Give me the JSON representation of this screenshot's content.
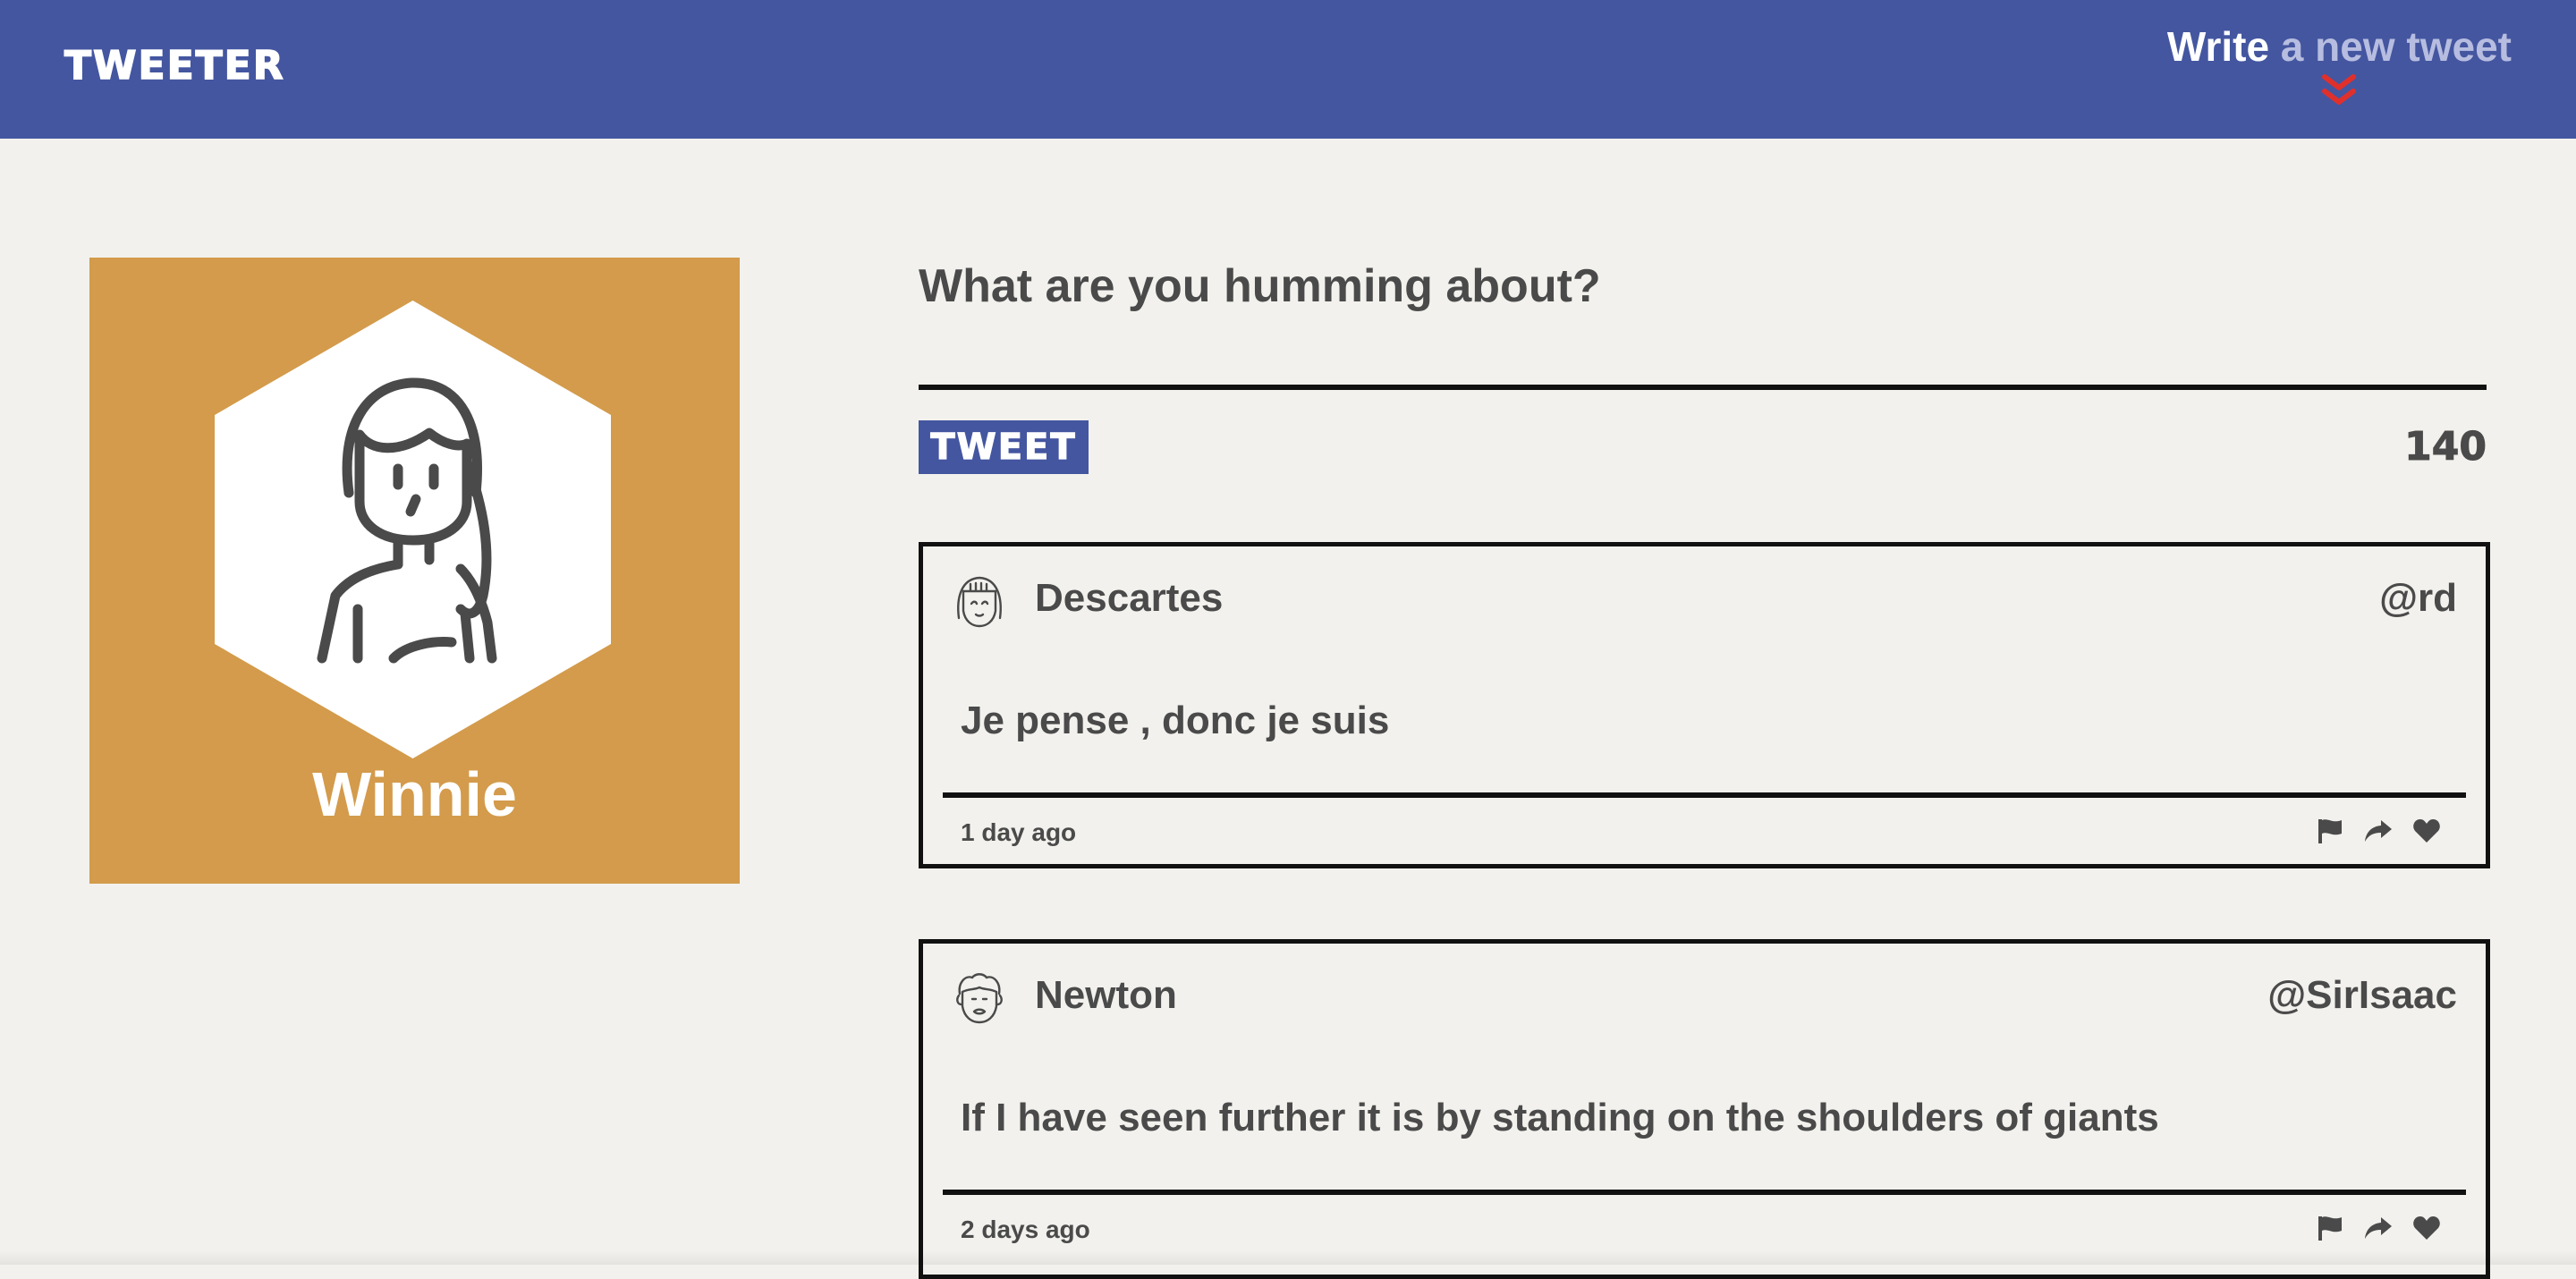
{
  "nav": {
    "brand": "TWEETER",
    "write_prefix": "Write",
    "write_suffix": " a new tweet",
    "accent_color": "#4456a0",
    "chevron_color": "#e0302c"
  },
  "profile": {
    "name": "Winnie",
    "background_color": "#d39b4b",
    "avatar_icon": "woman-avatar-icon"
  },
  "compose": {
    "prompt": "What are you humming about?",
    "submit_label": "TWEET",
    "char_counter": "140"
  },
  "tweets": [
    {
      "author": "Descartes",
      "handle": "@rd",
      "text": "Je pense , donc je suis",
      "time": "1 day ago",
      "avatar_icon": "girl-avatar-icon",
      "actions": [
        "flag-icon",
        "retweet-icon",
        "heart-icon"
      ]
    },
    {
      "author": "Newton",
      "handle": "@SirIsaac",
      "text": "If I have seen further it is by standing on the shoulders of giants",
      "time": "2 days ago",
      "avatar_icon": "man-avatar-icon",
      "actions": [
        "flag-icon",
        "retweet-icon",
        "heart-icon"
      ]
    }
  ]
}
